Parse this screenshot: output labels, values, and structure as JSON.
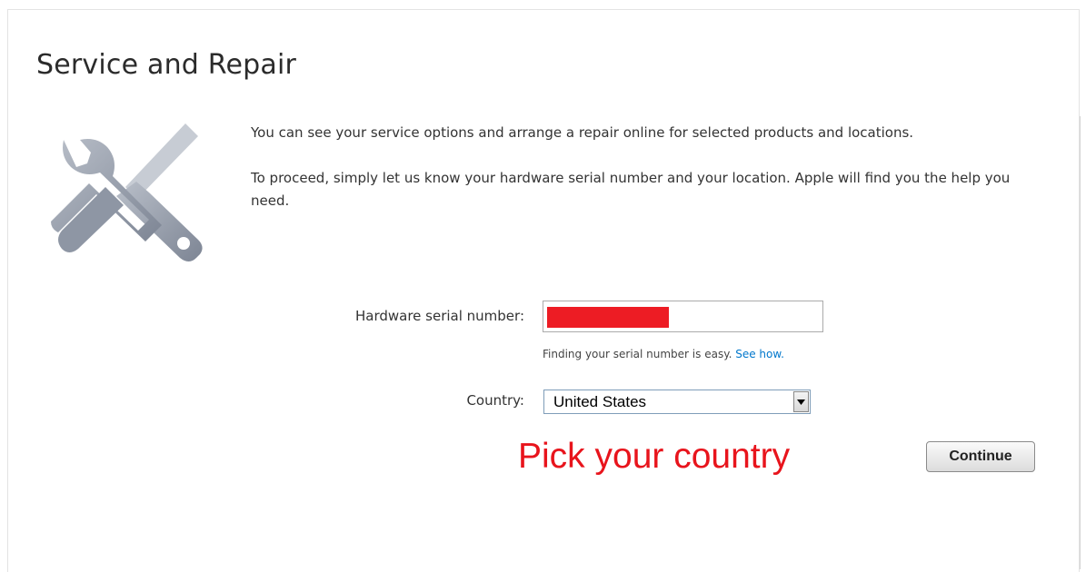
{
  "page": {
    "title": "Service and Repair"
  },
  "intro": {
    "paragraph1": "You can see your service options and arrange a repair online for selected products and locations.",
    "paragraph2": "To proceed, simply let us know your hardware serial number and your location. Apple will find you the help you need."
  },
  "form": {
    "serial_label": "Hardware serial number:",
    "serial_value": "",
    "serial_redaction_color": "#ed1c24",
    "hint_text": "Finding your serial number is easy.",
    "hint_link": "See how.",
    "country_label": "Country:",
    "country_value": "United States",
    "continue_label": "Continue"
  },
  "annotation": {
    "text": "Pick your country",
    "color": "#e8141c"
  },
  "icons": {
    "hero": "wrench-screwdriver-icon",
    "select": "chevron-down-icon"
  }
}
